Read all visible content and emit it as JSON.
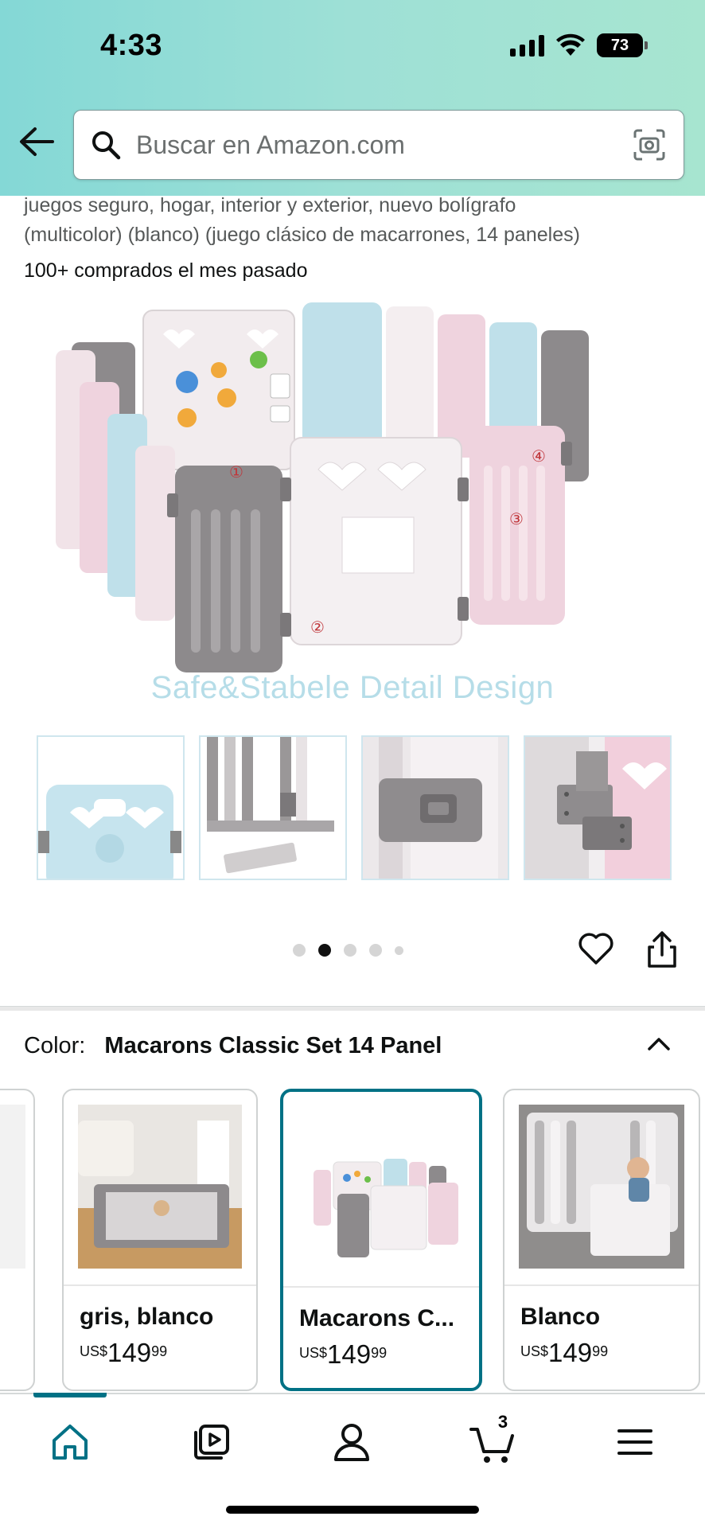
{
  "status_bar": {
    "time": "4:33",
    "battery": "73"
  },
  "search": {
    "placeholder": "Buscar en Amazon.com"
  },
  "product": {
    "title_line1": "juegos seguro, hogar, interior y exterior, nuevo bolígrafo",
    "title_line2": "(multicolor) (blanco) (juego clásico de macarrones, 14 paneles)",
    "bought_last_month": "100+ comprados el mes pasado",
    "image_caption": "Safe&Stabele Detail Design",
    "image_markers": [
      "①",
      "②",
      "③",
      "④"
    ]
  },
  "carousel": {
    "total_dots": 5,
    "active_index": 1
  },
  "color_selector": {
    "label": "Color:",
    "selected_value": "Macarons Classic Set 14 Panel",
    "options": [
      {
        "name": "gris, blanco",
        "currency": "US$",
        "price_whole": "149",
        "price_fraction": "99"
      },
      {
        "name": "Macarons C...",
        "currency": "US$",
        "price_whole": "149",
        "price_fraction": "99",
        "selected": true
      },
      {
        "name": "Blanco",
        "currency": "US$",
        "price_whole": "149",
        "price_fraction": "99"
      }
    ]
  },
  "bottom_nav": {
    "items": [
      "home-icon",
      "video-icon",
      "account-icon",
      "cart-icon",
      "menu-icon"
    ],
    "cart_count": "3",
    "active": "home-icon"
  },
  "colors": {
    "accent": "#007185",
    "header_start": "#84d8d6",
    "header_end": "#a7e5d0",
    "caption": "#b6dde8"
  }
}
